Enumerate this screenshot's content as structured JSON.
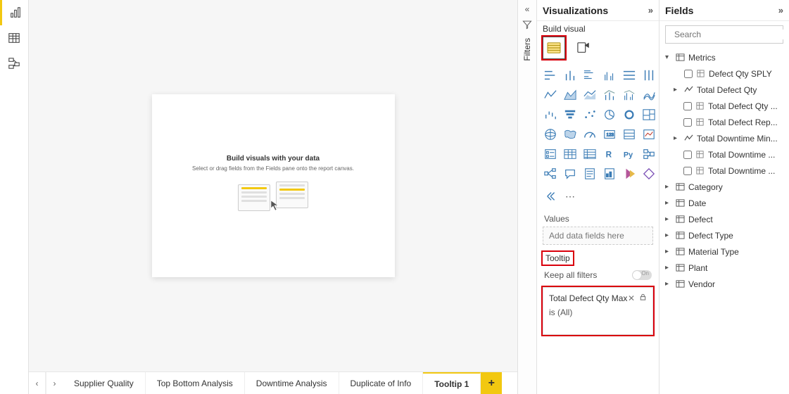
{
  "leftRail": {
    "items": [
      "report-view",
      "data-view",
      "model-view"
    ]
  },
  "canvas": {
    "placeholderTitle": "Build visuals with your data",
    "placeholderSub": "Select or drag fields from the Fields pane\nonto the report canvas."
  },
  "tabs": {
    "items": [
      "Supplier Quality",
      "Top Bottom Analysis",
      "Downtime Analysis",
      "Duplicate of Info",
      "Tooltip 1"
    ],
    "activeIndex": 4
  },
  "filtersLabel": "Filters",
  "visPane": {
    "title": "Visualizations",
    "sub": "Build visual",
    "valuesLabel": "Values",
    "valuesPlaceholder": "Add data fields here",
    "tooltipLabel": "Tooltip",
    "keepFilters": "Keep all filters",
    "toggleOnText": "On",
    "filterCard": {
      "field": "Total Defect Qty Max",
      "condition": "is (All)"
    }
  },
  "fieldsPane": {
    "title": "Fields",
    "searchPlaceholder": "Search",
    "tree": {
      "metrics": {
        "label": "Metrics",
        "leaf0": "Defect Qty SPLY",
        "totalDefect": {
          "label": "Total Defect Qty",
          "c0": "Total Defect Qty ...",
          "c1": "Total Defect Rep..."
        },
        "totalDowntime": {
          "label": "Total Downtime Min...",
          "c0": "Total Downtime ...",
          "c1": "Total Downtime ..."
        }
      },
      "tables": [
        "Category",
        "Date",
        "Defect",
        "Defect Type",
        "Material Type",
        "Plant",
        "Vendor"
      ]
    }
  }
}
